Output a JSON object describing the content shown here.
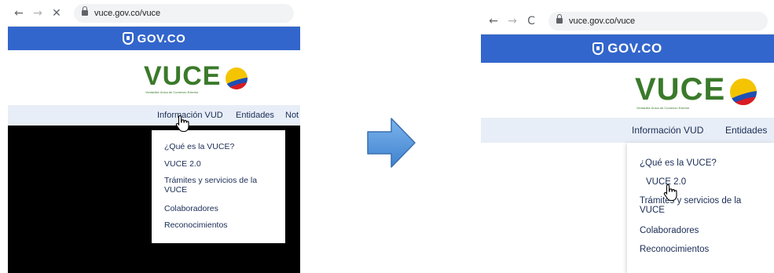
{
  "left": {
    "browser": {
      "back": "←",
      "forward": "→",
      "stop": "✕",
      "url": "vuce.gov.co/vuce"
    },
    "gov_banner": "GOV.CO",
    "logo": {
      "word": "VUCE",
      "tagline": "Ventanilla Única de Comercio Exterior"
    },
    "nav": {
      "info": "Información VUD",
      "entities": "Entidades",
      "partial": "Not"
    },
    "dropdown": [
      "¿Qué es la VUCE?",
      "VUCE 2.0",
      "Trámites y servicios de la VUCE",
      "Colaboradores",
      "Reconocimientos"
    ]
  },
  "right": {
    "browser": {
      "back": "←",
      "forward": "→",
      "reload": "C",
      "url": "vuce.gov.co/vuce"
    },
    "gov_banner": "GOV.CO",
    "logo": {
      "word": "VUCE",
      "tagline": "Ventanilla Única de Comercio Exterior"
    },
    "nav": {
      "info": "Información VUD",
      "entities": "Entidades"
    },
    "dropdown": [
      "¿Qué es la VUCE?",
      "VUCE 2.0",
      "Trámites y servicios de la VUCE",
      "Colaboradores",
      "Reconocimientos"
    ]
  },
  "colors": {
    "gov_blue": "#3366cc",
    "menu_bg": "#e8eef7",
    "logo_green": "#3a7a2a",
    "arrow": "#4a8fd6"
  },
  "icons": {
    "arrow": "right-arrow-icon",
    "cursor": "hand-pointer-icon"
  }
}
